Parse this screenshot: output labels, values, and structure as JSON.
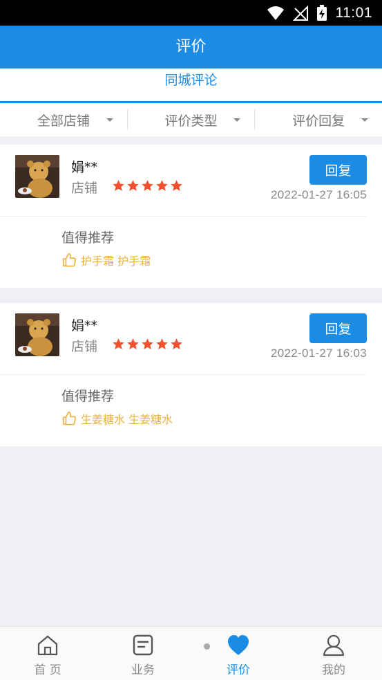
{
  "status_bar": {
    "time": "11:01"
  },
  "header": {
    "title": "评价"
  },
  "sub_tab": {
    "label": "同城评论"
  },
  "filters": [
    {
      "label": "全部店铺"
    },
    {
      "label": "评价类型"
    },
    {
      "label": "评价回复"
    }
  ],
  "reviews": [
    {
      "username": "娟**",
      "store_label": "店铺",
      "rating": 5,
      "time": "2022-01-27 16:05",
      "reply_label": "回复",
      "text": "值得推荐",
      "tags": "护手霜 护手霜"
    },
    {
      "username": "娟**",
      "store_label": "店铺",
      "rating": 5,
      "time": "2022-01-27 16:03",
      "reply_label": "回复",
      "text": "值得推荐",
      "tags": "生姜糖水 生姜糖水"
    }
  ],
  "bottom_nav": [
    {
      "label": "首 页",
      "icon": "home-icon",
      "active": false
    },
    {
      "label": "业务",
      "icon": "business-icon",
      "active": false
    },
    {
      "label": "评价",
      "icon": "heart-icon",
      "active": true
    },
    {
      "label": "我的",
      "icon": "user-icon",
      "active": false
    }
  ],
  "colors": {
    "primary": "#1a8ce6",
    "star": "#f0522e",
    "tag": "#e8b33c",
    "background": "#efeff4"
  }
}
